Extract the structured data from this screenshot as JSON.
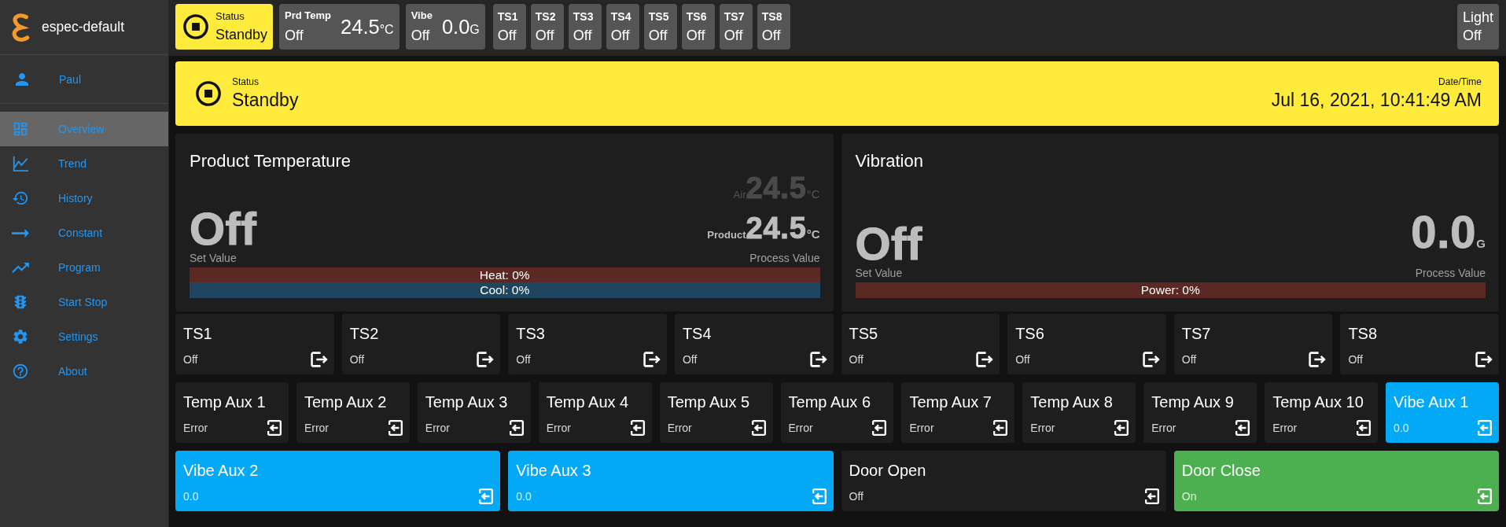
{
  "sidebar": {
    "app_name": "espec-default",
    "user": "Paul",
    "items": [
      {
        "label": "Overview",
        "selected": true
      },
      {
        "label": "Trend",
        "selected": false
      },
      {
        "label": "History",
        "selected": false
      },
      {
        "label": "Constant",
        "selected": false
      },
      {
        "label": "Program",
        "selected": false
      },
      {
        "label": "Start Stop",
        "selected": false
      },
      {
        "label": "Settings",
        "selected": false
      },
      {
        "label": "About",
        "selected": false
      }
    ]
  },
  "top_bar": {
    "status": {
      "label": "Status",
      "value": "Standby"
    },
    "readouts": [
      {
        "label": "Prd Temp",
        "value": "Off",
        "reading": "24.5",
        "unit": "°C"
      },
      {
        "label": "Vibe",
        "value": "Off",
        "reading": "0.0",
        "unit": "G"
      }
    ],
    "outputs": [
      {
        "label": "TS1",
        "value": "Off"
      },
      {
        "label": "TS2",
        "value": "Off"
      },
      {
        "label": "TS3",
        "value": "Off"
      },
      {
        "label": "TS4",
        "value": "Off"
      },
      {
        "label": "TS5",
        "value": "Off"
      },
      {
        "label": "TS6",
        "value": "Off"
      },
      {
        "label": "TS7",
        "value": "Off"
      },
      {
        "label": "TS8",
        "value": "Off"
      }
    ],
    "light": {
      "label": "Light",
      "value": "Off"
    }
  },
  "status_banner": {
    "label": "Status",
    "value": "Standby",
    "datetime_label": "Date/Time",
    "datetime": "Jul 16, 2021, 10:41:49 AM"
  },
  "panels": [
    {
      "title": "Product Temperature",
      "set_value": "Off",
      "set_label": "Set Value",
      "readings": [
        {
          "kind": "secondary",
          "label": "Air",
          "value": "24.5",
          "unit": "°C"
        },
        {
          "kind": "primary",
          "label": "Product",
          "value": "24.5",
          "unit": "°C"
        }
      ],
      "process_label": "Process Value",
      "bars": [
        {
          "text": "Heat: 0%",
          "color": "#5c2824"
        },
        {
          "text": "Cool: 0%",
          "color": "#1f4560"
        }
      ]
    },
    {
      "title": "Vibration",
      "set_value": "Off",
      "set_label": "Set Value",
      "readings": [
        {
          "kind": "main",
          "value": "0.0",
          "unit": "G"
        }
      ],
      "process_label": "Process Value",
      "bars": [
        {
          "text": "Power: 0%",
          "color": "#5c2824"
        }
      ]
    }
  ],
  "tile_rows": [
    {
      "tiles": [
        {
          "title": "TS1",
          "value": "Off",
          "kind": "output",
          "color": "#1e1e1e"
        },
        {
          "title": "TS2",
          "value": "Off",
          "kind": "output",
          "color": "#1e1e1e"
        },
        {
          "title": "TS3",
          "value": "Off",
          "kind": "output",
          "color": "#1e1e1e"
        },
        {
          "title": "TS4",
          "value": "Off",
          "kind": "output",
          "color": "#1e1e1e"
        },
        {
          "title": "TS5",
          "value": "Off",
          "kind": "output",
          "color": "#1e1e1e"
        },
        {
          "title": "TS6",
          "value": "Off",
          "kind": "output",
          "color": "#1e1e1e"
        },
        {
          "title": "TS7",
          "value": "Off",
          "kind": "output",
          "color": "#1e1e1e"
        },
        {
          "title": "TS8",
          "value": "Off",
          "kind": "output",
          "color": "#1e1e1e"
        }
      ]
    },
    {
      "tiles": [
        {
          "title": "Temp Aux 1",
          "value": "Error",
          "kind": "input",
          "color": "#1e1e1e"
        },
        {
          "title": "Temp Aux 2",
          "value": "Error",
          "kind": "input",
          "color": "#1e1e1e"
        },
        {
          "title": "Temp Aux 3",
          "value": "Error",
          "kind": "input",
          "color": "#1e1e1e"
        },
        {
          "title": "Temp Aux 4",
          "value": "Error",
          "kind": "input",
          "color": "#1e1e1e"
        },
        {
          "title": "Temp Aux 5",
          "value": "Error",
          "kind": "input",
          "color": "#1e1e1e"
        },
        {
          "title": "Temp Aux 6",
          "value": "Error",
          "kind": "input",
          "color": "#1e1e1e"
        },
        {
          "title": "Temp Aux 7",
          "value": "Error",
          "kind": "input",
          "color": "#1e1e1e"
        },
        {
          "title": "Temp Aux 8",
          "value": "Error",
          "kind": "input",
          "color": "#1e1e1e"
        },
        {
          "title": "Temp Aux 9",
          "value": "Error",
          "kind": "input",
          "color": "#1e1e1e"
        },
        {
          "title": "Temp Aux 10",
          "value": "Error",
          "kind": "input",
          "color": "#1e1e1e"
        },
        {
          "title": "Vibe Aux 1",
          "value": "0.0",
          "kind": "input",
          "color": "#03a9f4"
        }
      ]
    },
    {
      "tiles": [
        {
          "title": "Vibe Aux 2",
          "value": "0.0",
          "kind": "input",
          "color": "#03a9f4"
        },
        {
          "title": "Vibe Aux 3",
          "value": "0.0",
          "kind": "input",
          "color": "#03a9f4"
        },
        {
          "title": "Door Open",
          "value": "Off",
          "kind": "input",
          "color": "#1e1e1e"
        },
        {
          "title": "Door Close",
          "value": "On",
          "kind": "input",
          "color": "#4caf50"
        }
      ]
    }
  ]
}
